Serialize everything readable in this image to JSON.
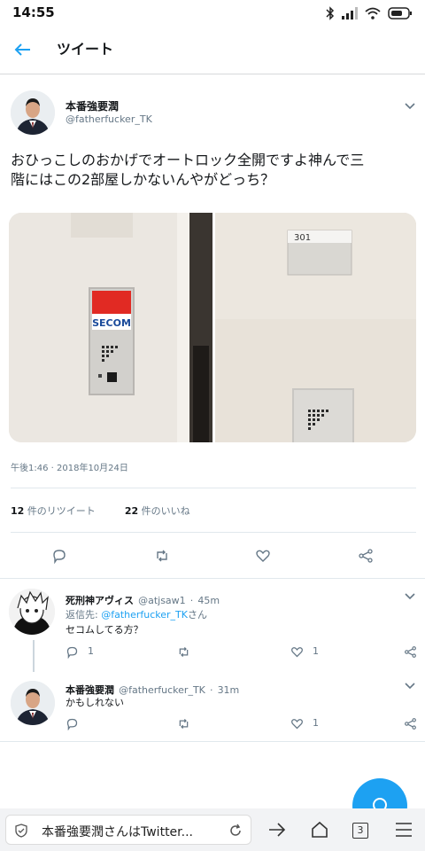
{
  "status_bar": {
    "time": "14:55"
  },
  "header": {
    "title": "ツイート",
    "back_icon": "back-arrow-icon"
  },
  "main_tweet": {
    "name": "本番強要潤",
    "handle": "@fatherfucker_TK",
    "text": "おひっこしのおかげでオートロック全開ですよ神んで三階にはこの2部屋しかないんやがどっち？",
    "photo": {
      "room_number": "301",
      "brand": "SECOM"
    },
    "timestamp": "午後1:46 · 2018年10月24日",
    "retweets": {
      "count": "12",
      "label": "件のリツイート"
    },
    "likes": {
      "count": "22",
      "label": "件のいいね"
    }
  },
  "replies": [
    {
      "name": "死刑神アヴィス",
      "handle": "@atjsaw1",
      "time": "45m",
      "reply_to_prefix": "返信先: ",
      "reply_to_handle": "@fatherfucker_TK",
      "reply_to_suffix": "さん",
      "text": "セコムしてる方？",
      "reply_count": "1",
      "like_count": "1"
    },
    {
      "name": "本番強要潤",
      "handle": "@fatherfucker_TK",
      "time": "31m",
      "text": "かもしれない",
      "like_count": "1"
    }
  ],
  "browser": {
    "url_text": "本番強要潤さんはTwitter...",
    "tab_count": "3"
  },
  "colors": {
    "accent": "#1da1f2",
    "muted": "#657786"
  }
}
